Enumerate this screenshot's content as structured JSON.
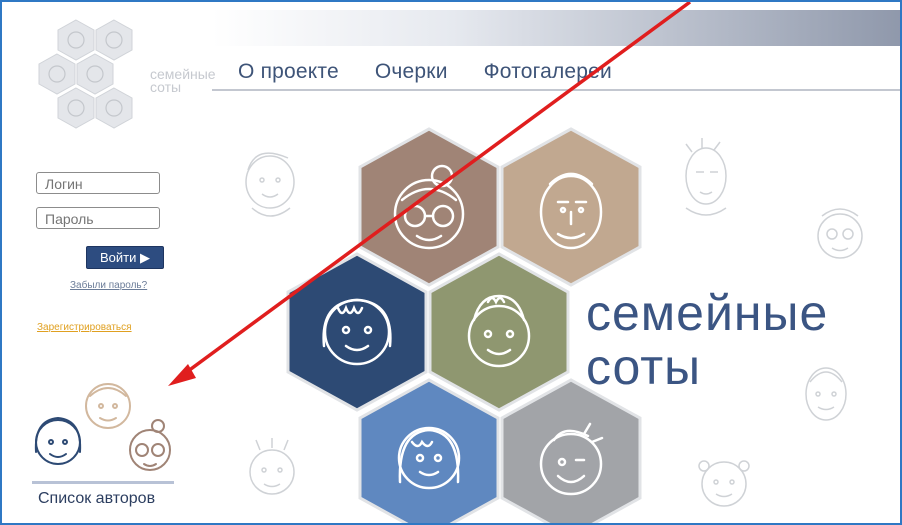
{
  "nav": {
    "about": "О проекте",
    "essays": "Очерки",
    "galleries": "Фотогалереи"
  },
  "logo": {
    "line1": "семейные",
    "line2": "соты"
  },
  "login": {
    "login_placeholder": "Логин",
    "password_placeholder": "Пароль",
    "submit_label": "Войти ▶",
    "forgot_label": "Забыли пароль?",
    "register_label": "Зарегистрироваться"
  },
  "authors": {
    "label": "Список авторов"
  },
  "hero": {
    "line1": "семейные",
    "line2": "соты"
  },
  "colors": {
    "frame": "#2f78c4",
    "nav_text": "#3e5478",
    "hex_taupe": "#a08476",
    "hex_tan": "#c1a890",
    "hex_navy": "#2d4a74",
    "hex_olive": "#8f9770",
    "hex_blue": "#5f88c0",
    "hex_gray": "#a2a4a8",
    "arrow": "#e01e1e"
  }
}
